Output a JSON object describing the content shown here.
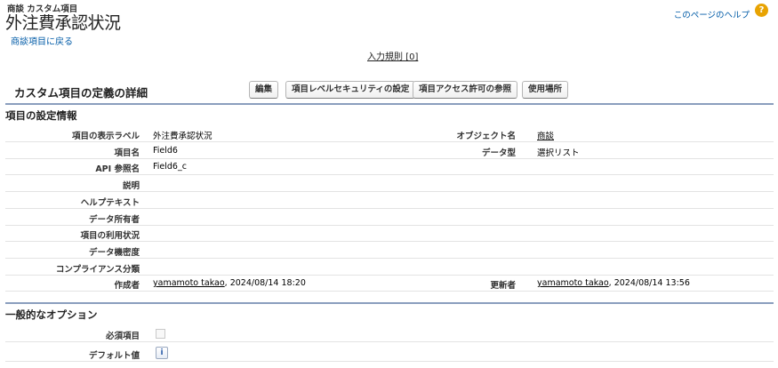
{
  "header": {
    "breadcrumb": "商談 カスタム項目",
    "title": "外注費承認状況",
    "back_link": "商談項目に戻る",
    "help_link": "このページのヘルプ",
    "help_icon": "?"
  },
  "validation_rules_link": "入力規則 [0]",
  "detail": {
    "title": "カスタム項目の定義の詳細",
    "buttons": {
      "edit": "編集",
      "field_level_security": "項目レベルセキュリティの設定",
      "field_access": "項目アクセス許可の参照",
      "where_used": "使用場所"
    }
  },
  "field_info": {
    "section_title": "項目の設定情報",
    "rows": [
      {
        "label": "項目の表示ラベル",
        "value": "外注費承認状況",
        "label2": "オブジェクト名",
        "value2": "商談"
      },
      {
        "label": "項目名",
        "value": "Field6",
        "label2": "データ型",
        "value2": "選択リスト"
      },
      {
        "label": "API 参照名",
        "value": "Field6_c",
        "label2": "",
        "value2": ""
      },
      {
        "label": "説明",
        "value": "",
        "label2": "",
        "value2": ""
      },
      {
        "label": "ヘルプテキスト",
        "value": "",
        "label2": "",
        "value2": ""
      },
      {
        "label": "データ所有者",
        "value": "",
        "label2": "",
        "value2": ""
      },
      {
        "label": "項目の利用状況",
        "value": "",
        "label2": "",
        "value2": ""
      },
      {
        "label": "データ機密度",
        "value": "",
        "label2": "",
        "value2": ""
      },
      {
        "label": "コンプライアンス分類",
        "value": "",
        "label2": "",
        "value2": ""
      }
    ],
    "created_by": {
      "label": "作成者",
      "user": "yamamoto takao",
      "date": ", 2024/08/14 18:20"
    },
    "modified_by": {
      "label": "更新者",
      "user": "yamamoto takao",
      "date": ", 2024/08/14 13:56"
    }
  },
  "general_options": {
    "section_title": "一般的なオプション",
    "required_label": "必須項目",
    "required_checked": false,
    "default_label": "デフォルト値",
    "default_icon": "i"
  }
}
